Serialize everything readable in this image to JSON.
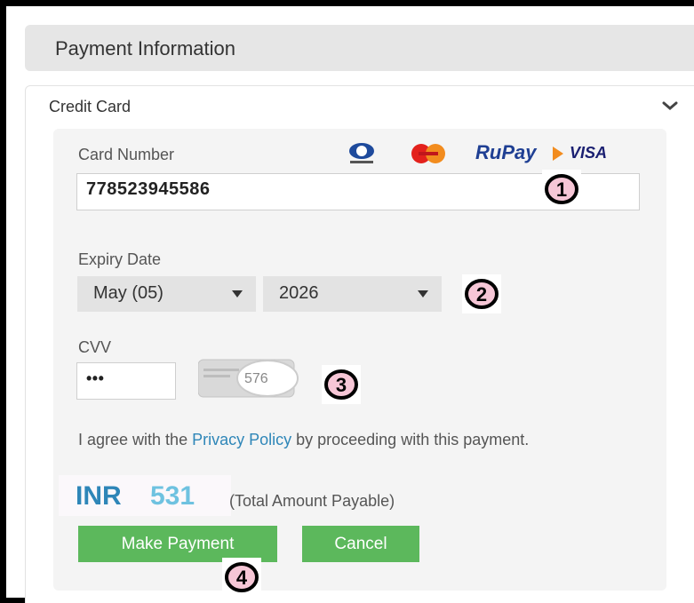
{
  "header": {
    "title": "Payment Information"
  },
  "section": {
    "title": "Credit Card"
  },
  "card_number": {
    "label": "Card Number",
    "value": "778523945586"
  },
  "card_logos": {
    "rupay": "RuPay",
    "visa": "VISA"
  },
  "expiry": {
    "label": "Expiry Date",
    "month": "May (05)",
    "year": "2026"
  },
  "cvv": {
    "label": "CVV",
    "value": "•••",
    "sample_digits": "576"
  },
  "agreement": {
    "prefix": "I agree with the ",
    "link": "Privacy Policy",
    "suffix": " by proceeding with this payment."
  },
  "amount": {
    "currency": "INR",
    "value": "531",
    "note": "(Total Amount Payable)"
  },
  "buttons": {
    "make_payment": "Make Payment",
    "cancel": "Cancel"
  },
  "markers": [
    "1",
    "2",
    "3",
    "4"
  ],
  "colors": {
    "accent": "#2e86b8",
    "button": "#5cb85c",
    "marker_fill": "#f6c6d6"
  }
}
